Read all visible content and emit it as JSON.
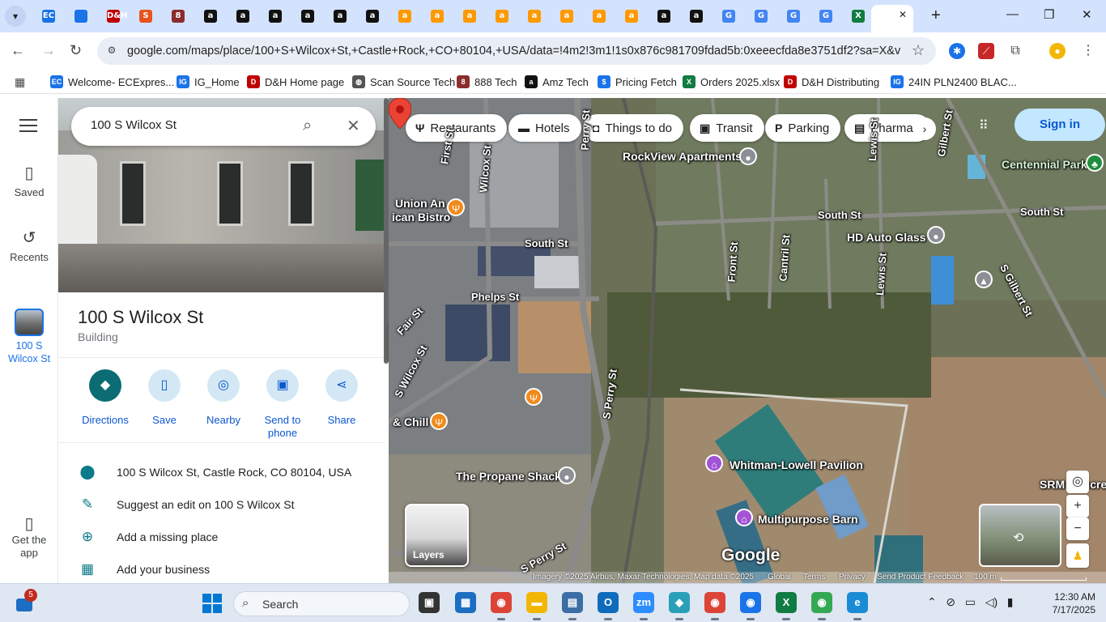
{
  "browser": {
    "tabs": [
      {
        "icon": "chevron-down-icon"
      },
      {
        "icon": "ec-icon",
        "label": "EC",
        "color": "#1a73e8"
      },
      {
        "icon": "ig-icon",
        "label": "",
        "color": "#1a73e8"
      },
      {
        "icon": "dh-icon",
        "label": "D&H",
        "color": "#c00000"
      },
      {
        "icon": "swirl-icon",
        "label": "S",
        "color": "#e8531d"
      },
      {
        "icon": "888-icon",
        "label": "8",
        "color": "#8b2d2d"
      },
      {
        "icon": "amazon-icon",
        "label": "a",
        "color": "#111111"
      },
      {
        "icon": "amazon-icon",
        "label": "a",
        "color": "#111111"
      },
      {
        "icon": "amazon-icon",
        "label": "a",
        "color": "#111111"
      },
      {
        "icon": "amazon-icon",
        "label": "a",
        "color": "#111111"
      },
      {
        "icon": "amazon-icon",
        "label": "a",
        "color": "#111111"
      },
      {
        "icon": "amazon-icon",
        "label": "a",
        "color": "#111111"
      },
      {
        "icon": "amazon-smile-icon",
        "label": "a",
        "color": "#ff9900"
      },
      {
        "icon": "amazon-smile-icon",
        "label": "a",
        "color": "#ff9900"
      },
      {
        "icon": "amazon-smile-icon",
        "label": "a",
        "color": "#ff9900"
      },
      {
        "icon": "amazon-smile-icon",
        "label": "a",
        "color": "#ff9900"
      },
      {
        "icon": "amazon-smile-icon",
        "label": "a",
        "color": "#ff9900"
      },
      {
        "icon": "amazon-smile-icon",
        "label": "a",
        "color": "#ff9900"
      },
      {
        "icon": "amazon-smile-icon",
        "label": "a",
        "color": "#ff9900"
      },
      {
        "icon": "amazon-smile-icon",
        "label": "a",
        "color": "#ff9900"
      },
      {
        "icon": "amazon-icon",
        "label": "a",
        "color": "#111111"
      },
      {
        "icon": "amazon-icon",
        "label": "a",
        "color": "#111111"
      },
      {
        "icon": "google-icon",
        "label": "G",
        "color": "#4285f4"
      },
      {
        "icon": "google-icon",
        "label": "G",
        "color": "#4285f4"
      },
      {
        "icon": "google-icon",
        "label": "G",
        "color": "#4285f4"
      },
      {
        "icon": "google-icon",
        "label": "G",
        "color": "#4285f4"
      },
      {
        "icon": "excel-icon",
        "label": "X",
        "color": "#107c41"
      }
    ],
    "new_tab": "+",
    "window_controls": {
      "minimize": "—",
      "maximize": "❐",
      "close": "✕"
    },
    "url": "google.com/maps/place/100+S+Wilcox+St,+Castle+Rock,+CO+80104,+USA/data=!4m2!3m1!1s0x876c981709fdad5b:0xeeecfda8e3751df2?sa=X&ved=..."
  },
  "bookmarks": [
    {
      "label": "Welcome- ECExpres...",
      "icon": "ec-icon",
      "color": "#1a73e8",
      "glyph": "EC"
    },
    {
      "label": "IG_Home",
      "icon": "ig-icon",
      "color": "#1a73e8",
      "glyph": "IG"
    },
    {
      "label": "D&H Home page",
      "icon": "dh-icon",
      "color": "#c00000",
      "glyph": "D"
    },
    {
      "label": "Scan Source Tech",
      "icon": "globe-icon",
      "color": "#555555",
      "glyph": "◍"
    },
    {
      "label": "888 Tech",
      "icon": "888-icon",
      "color": "#8b2d2d",
      "glyph": "8"
    },
    {
      "label": "Amz Tech",
      "icon": "amazon-icon",
      "color": "#111111",
      "glyph": "a"
    },
    {
      "label": "Pricing Fetch",
      "icon": "dollar-icon",
      "color": "#1a73e8",
      "glyph": "$"
    },
    {
      "label": "Orders 2025.xlsx",
      "icon": "excel-icon",
      "color": "#107c41",
      "glyph": "X"
    },
    {
      "label": "D&H Distributing",
      "icon": "dh-icon",
      "color": "#c00000",
      "glyph": "D"
    },
    {
      "label": "24IN PLN2400 BLAC...",
      "icon": "ig-icon",
      "color": "#1a73e8",
      "glyph": "IG"
    }
  ],
  "rail": {
    "saved": "Saved",
    "recents": "Recents",
    "recent_place_line1": "100 S",
    "recent_place_line2": "Wilcox St",
    "get_app_line1": "Get the",
    "get_app_line2": "app"
  },
  "search": {
    "value": "100 S Wilcox St"
  },
  "place": {
    "title": "100 S Wilcox St",
    "type": "Building"
  },
  "actions": [
    {
      "label": "Directions",
      "label2": "",
      "icon": "directions-icon",
      "glyph": "◆"
    },
    {
      "label": "Save",
      "label2": "",
      "icon": "bookmark-icon",
      "glyph": "▯"
    },
    {
      "label": "Nearby",
      "label2": "",
      "icon": "nearby-icon",
      "glyph": "◎"
    },
    {
      "label": "Send to",
      "label2": "phone",
      "icon": "send-to-phone-icon",
      "glyph": "▣"
    },
    {
      "label": "Share",
      "label2": "",
      "icon": "share-icon",
      "glyph": "⋖"
    }
  ],
  "info_rows": [
    {
      "text": "100 S Wilcox St, Castle Rock, CO 80104, USA",
      "icon": "location-pin-icon",
      "glyph": "⬤"
    },
    {
      "text": "Suggest an edit on 100 S Wilcox St",
      "icon": "pencil-icon",
      "glyph": "✎"
    },
    {
      "text": "Add a missing place",
      "icon": "add-location-icon",
      "glyph": "⊕"
    },
    {
      "text": "Add your business",
      "icon": "add-business-icon",
      "glyph": "▦"
    }
  ],
  "map": {
    "chips": [
      {
        "label": "Restaurants",
        "icon": "fork-knife-icon",
        "glyph": "Ψ"
      },
      {
        "label": "Hotels",
        "icon": "bed-icon",
        "glyph": "▬"
      },
      {
        "label": "Things to do",
        "icon": "camera-icon",
        "glyph": "◘"
      },
      {
        "label": "Transit",
        "icon": "transit-icon",
        "glyph": "▣"
      },
      {
        "label": "Parking",
        "icon": "parking-icon",
        "glyph": "P"
      },
      {
        "label": "Pharmac",
        "icon": "pharmacy-icon",
        "glyph": "▤"
      }
    ],
    "sign_in": "Sign in",
    "labels": {
      "rockview": "RockView Apartments",
      "centennial": "Centennial Park",
      "union": "Union An",
      "union2": "ican Bistro",
      "hd_auto": "HD Auto Glass",
      "chill": "& Chill",
      "propane": "The Propane Shack",
      "whitman": "Whitman-Lowell Pavilion",
      "barn": "Multipurpose Barn",
      "srm": "SRM Concret",
      "first_st": "First St",
      "wilcox_st": "Wilcox St",
      "perry_st": "Perry St",
      "south_st_1": "South St",
      "south_st_2": "South St",
      "south_st_3": "South St",
      "phelps_st": "Phelps St",
      "fair_st": "Fair St",
      "s_wilcox_st": "S Wilcox St",
      "s_perry_st_1": "S Perry St",
      "s_perry_st_2": "S Perry St",
      "front_st": "Front St",
      "cantril_st": "Cantril St",
      "lewis_st_1": "Lewis St",
      "lewis_st_2": "Lewis St",
      "gilbert_st": "Gilbert St",
      "s_gilbert_st": "S Gilbert St"
    },
    "layers": "Layers",
    "google_logo": "Google",
    "attribution": {
      "imagery": "Imagery ©2025 Airbus, Maxar Technologies, Map data ©2025",
      "global": "Global",
      "terms": "Terms",
      "privacy": "Privacy",
      "feedback": "Send Product Feedback",
      "scale": "100 m"
    },
    "zoom_in": "+",
    "zoom_out": "−"
  },
  "taskbar": {
    "notification_count": "5",
    "search_placeholder": "Search",
    "time": "12:30 AM",
    "date": "7/17/2025",
    "apps": [
      {
        "icon": "task-view-icon",
        "glyph": "▣",
        "color": "#333333"
      },
      {
        "icon": "store-icon",
        "glyph": "▦",
        "color": "#1b6ec2"
      },
      {
        "icon": "chrome-icon",
        "glyph": "◉",
        "color": "#db4437"
      },
      {
        "icon": "file-explorer-icon",
        "glyph": "▬",
        "color": "#f2b705"
      },
      {
        "icon": "calculator-icon",
        "glyph": "▤",
        "color": "#3a6ea5"
      },
      {
        "icon": "outlook-icon",
        "glyph": "O",
        "color": "#0f6cbd"
      },
      {
        "icon": "zoom-icon",
        "glyph": "zm",
        "color": "#2d8cff"
      },
      {
        "icon": "copilot-icon",
        "glyph": "◆",
        "color": "#2aa0b8"
      },
      {
        "icon": "chrome-profile-icon",
        "glyph": "◉",
        "color": "#db4437"
      },
      {
        "icon": "chrome-profile-icon",
        "glyph": "◉",
        "color": "#1a73e8"
      },
      {
        "icon": "excel-icon",
        "glyph": "X",
        "color": "#107c41"
      },
      {
        "icon": "chrome-profile-icon",
        "glyph": "◉",
        "color": "#34a853"
      },
      {
        "icon": "edge-icon",
        "glyph": "e",
        "color": "#1b8bd6"
      }
    ]
  }
}
